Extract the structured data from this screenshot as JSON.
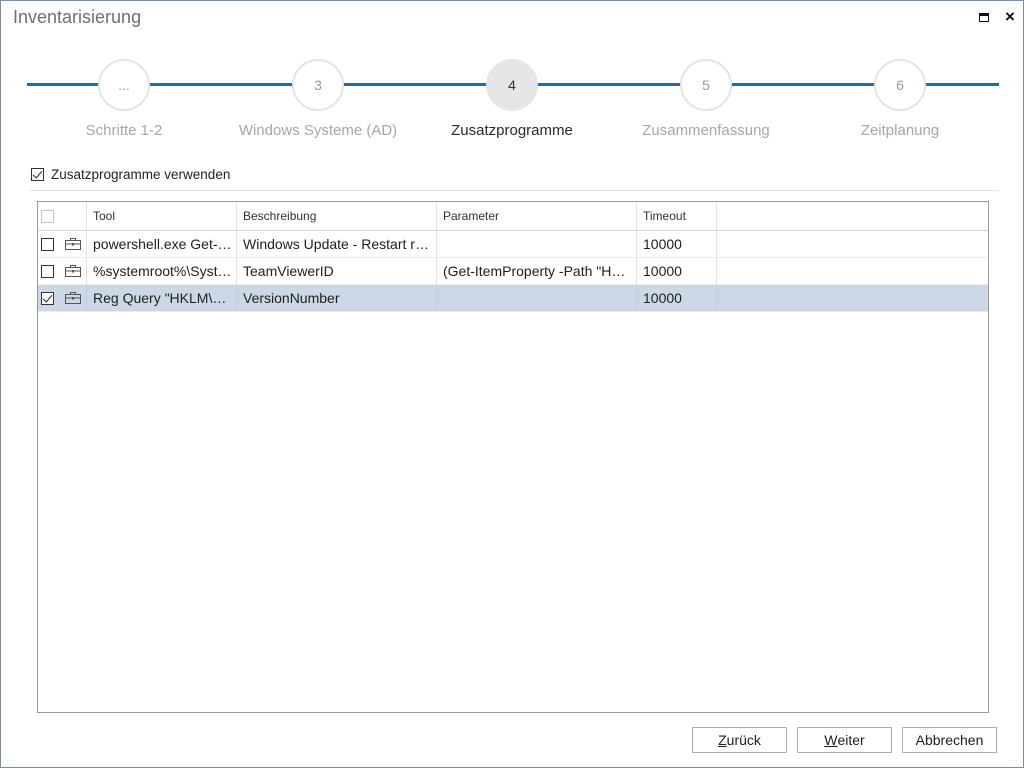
{
  "window": {
    "title": "Inventarisierung",
    "close_glyph": "×"
  },
  "stepper": {
    "steps": [
      {
        "number": "...",
        "label": "Schritte 1-2",
        "active": false
      },
      {
        "number": "3",
        "label": "Windows Systeme (AD)",
        "active": false
      },
      {
        "number": "4",
        "label": "Zusatzprogramme",
        "active": true
      },
      {
        "number": "5",
        "label": "Zusammenfassung",
        "active": false
      },
      {
        "number": "6",
        "label": "Zeitplanung",
        "active": false
      }
    ],
    "line_color": "#1f6bb0"
  },
  "use_checkbox": {
    "label": "Zusatzprogramme verwenden",
    "checked": true
  },
  "table": {
    "columns": [
      "Tool",
      "Beschreibung",
      "Parameter",
      "Timeout"
    ],
    "rows": [
      {
        "checked": false,
        "selected": false,
        "icon": "toolbox-icon",
        "tool": "powershell.exe Get-W...",
        "description": "Windows Update - Restart re...",
        "parameter": "",
        "timeout": "10000"
      },
      {
        "checked": false,
        "selected": false,
        "icon": "toolbox-icon",
        "tool": "%systemroot%\\Syste...",
        "description": "TeamViewerID",
        "parameter": "(Get-ItemProperty -Path \"HK...",
        "timeout": "10000"
      },
      {
        "checked": true,
        "selected": true,
        "icon": "toolbox-icon",
        "tool": "Reg Query \"HKLM\\S...",
        "description": "VersionNumber",
        "parameter": "",
        "timeout": "10000"
      }
    ],
    "selected_row_color": "#cdd8e6"
  },
  "buttons": {
    "back": {
      "mnemonic": "Z",
      "rest": "urück"
    },
    "next": {
      "mnemonic": "W",
      "rest": "eiter"
    },
    "cancel": {
      "label": "Abbrechen"
    }
  }
}
